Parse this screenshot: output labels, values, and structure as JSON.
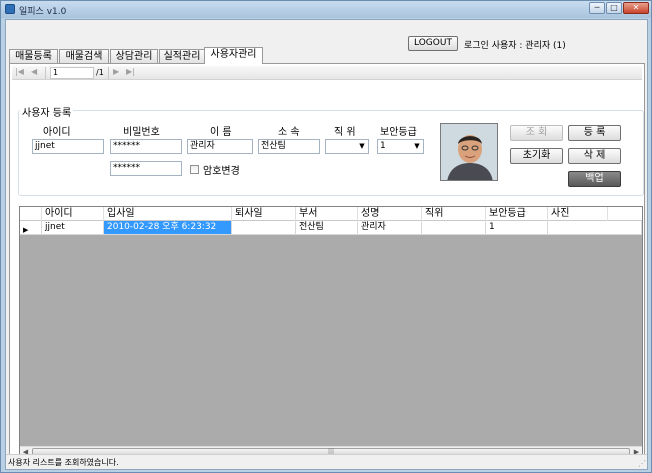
{
  "window": {
    "title": "일피스 v1.0",
    "min_label": "─",
    "max_label": "□",
    "close_label": "✕"
  },
  "header": {
    "logout_label": "LOGOUT",
    "login_user": "로그인 사용자 : 관리자 (1)"
  },
  "tabs": [
    {
      "label": "매물등록",
      "active": false
    },
    {
      "label": "매물검색",
      "active": false
    },
    {
      "label": "상담관리",
      "active": false
    },
    {
      "label": "실적관리",
      "active": false
    },
    {
      "label": "사용자관리",
      "active": true
    }
  ],
  "navigator": {
    "position": "1",
    "total": "/1",
    "first_icon": "|◀",
    "prev_icon": "◀",
    "next_icon": "▶",
    "last_icon": "▶|"
  },
  "form": {
    "group_title": "사용자 등록",
    "labels": {
      "user_id": "아이디",
      "password": "비밀번호",
      "name": "이  름",
      "dept": "소 속",
      "position": "직 위",
      "security": "보안등급"
    },
    "values": {
      "user_id": "jjnet",
      "password": "******",
      "password_confirm": "******",
      "name": "관리자",
      "dept": "전산팀",
      "position": "",
      "security": "1"
    },
    "change_password_label": "암호변경",
    "change_password_checked": false
  },
  "buttons": {
    "search": "조 회",
    "register": "등 록",
    "reset": "초기화",
    "delete": "삭 제",
    "backup": "백업"
  },
  "grid": {
    "columns": [
      "아이디",
      "입사일",
      "퇴사일",
      "부서",
      "성명",
      "직위",
      "보안등급",
      "사진"
    ],
    "rows": [
      {
        "user_id": "jjnet",
        "hire_date": "2010-02-28 오후 6:23:32",
        "leave_date": "",
        "dept": "전산팀",
        "name": "관리자",
        "position": "",
        "security": "1",
        "photo": ""
      }
    ],
    "current_row_icon": "▶",
    "scroll_left": "◀",
    "scroll_right": "▶",
    "scroll_thumb": "|||"
  },
  "status": {
    "text": "사용자 리스트를 조회하였습니다.",
    "grip": "⋰"
  }
}
